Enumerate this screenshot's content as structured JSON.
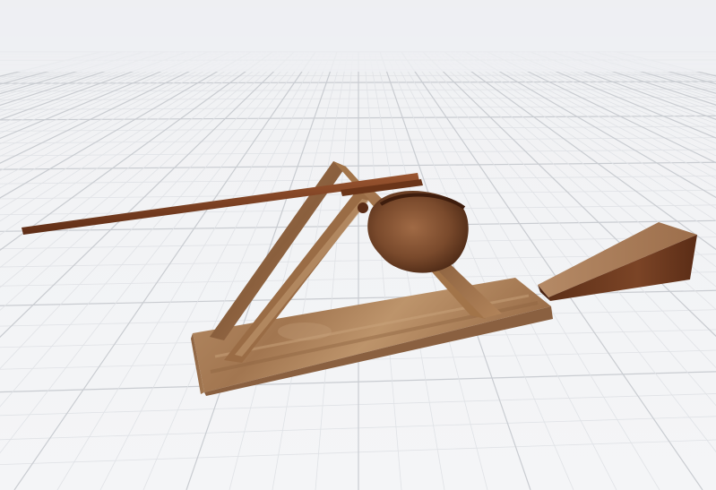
{
  "scene": {
    "kind": "3d-viewport",
    "background_color": "#eef0f3",
    "grid_major_color": "#c9ccd1",
    "grid_minor_color": "#e0e2e6",
    "objects": [
      {
        "name": "catapult-base",
        "material": "light-wood",
        "color": "#b08459"
      },
      {
        "name": "catapult-a-frame",
        "material": "light-wood",
        "color": "#9c6f4a"
      },
      {
        "name": "catapult-throwing-arm",
        "material": "dark-wood",
        "color": "#7a3f22"
      },
      {
        "name": "catapult-bucket",
        "material": "dark-wood",
        "color": "#7a4a2c"
      },
      {
        "name": "ramp-wedge",
        "material": "dark-wood",
        "color": "#6b3a22"
      }
    ]
  }
}
